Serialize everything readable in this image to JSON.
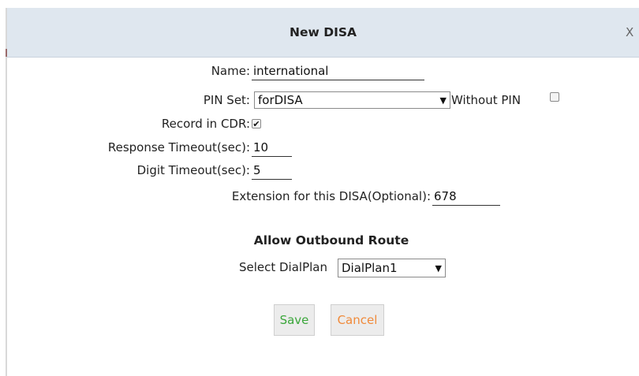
{
  "dialog": {
    "title": "New DISA",
    "close_label": "X"
  },
  "form": {
    "name": {
      "label": "Name:",
      "value": "international"
    },
    "pin_set": {
      "label": "PIN Set:",
      "value": "forDISA"
    },
    "without_pin": {
      "label": "Without PIN",
      "checked": false
    },
    "record_in_cdr": {
      "label": "Record in CDR:",
      "checked": true,
      "check_glyph": "✔"
    },
    "response_timeout": {
      "label": "Response Timeout(sec):",
      "value": "10"
    },
    "digit_timeout": {
      "label": "Digit Timeout(sec):",
      "value": "5"
    },
    "extension": {
      "label": "Extension for this DISA(Optional):",
      "value": "678"
    }
  },
  "outbound": {
    "heading": "Allow Outbound Route",
    "select_label": "Select DialPlan",
    "select_value": "DialPlan1"
  },
  "buttons": {
    "save_label": "Save",
    "cancel_label": "Cancel"
  },
  "icons": {
    "dropdown": "▼"
  },
  "colors": {
    "titlebar_bg": "#dfe7ef",
    "save_text": "#3aa63a",
    "cancel_text": "#f08a3a"
  }
}
